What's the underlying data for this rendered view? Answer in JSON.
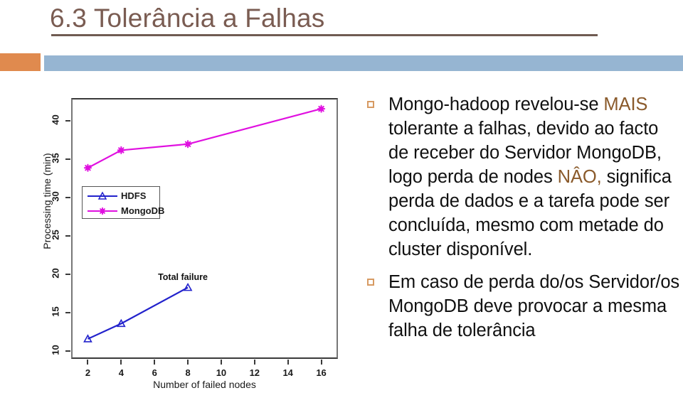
{
  "slide": {
    "title": "6.3 Tolerância a Falhas",
    "title_color": "#7A5C52",
    "accent_orange": "#E08A4E",
    "band_blue": "#96B5D2",
    "highlight_color": "#8A5A2B"
  },
  "chart_data": {
    "type": "line",
    "title": "",
    "xlabel": "Number of failed nodes",
    "ylabel": "Processing time (min)",
    "xlim": [
      1,
      17
    ],
    "ylim": [
      9,
      43
    ],
    "xticks": [
      2,
      4,
      6,
      8,
      10,
      12,
      14,
      16
    ],
    "yticks": [
      10,
      15,
      20,
      25,
      30,
      35,
      40
    ],
    "grid": false,
    "legend_position": "center-left",
    "annotations": [
      {
        "text": "Total failure",
        "x": 8,
        "y": 19.6
      }
    ],
    "series": [
      {
        "name": "HDFS",
        "color": "#2222CC",
        "marker": "triangle",
        "x": [
          2,
          4,
          8
        ],
        "values": [
          11.6,
          13.6,
          18.3
        ]
      },
      {
        "name": "MongoDB",
        "color": "#E010E0",
        "marker": "star",
        "x": [
          2,
          4,
          8,
          16
        ],
        "values": [
          33.9,
          36.2,
          37.0,
          41.6
        ]
      }
    ]
  },
  "content": {
    "bullets": [
      {
        "id": "bullet-tolerancia",
        "segments": [
          {
            "text": "Mongo-hadoop revelou-se ",
            "highlight": false
          },
          {
            "text": "MAIS",
            "highlight": true
          },
          {
            "text": " tolerante a falhas, devido ao facto de receber do Servidor MongoDB, logo perda de nodes ",
            "highlight": false
          },
          {
            "text": "NÂO,",
            "highlight": true
          },
          {
            "text": " significa perda de dados e a tarefa pode ser concluída, mesmo com metade do cluster disponível.",
            "highlight": false
          }
        ]
      },
      {
        "id": "bullet-perda-servidor",
        "segments": [
          {
            "text": "Em caso de perda do/os Servidor/os MongoDB deve provocar a mesma falha de tolerância",
            "highlight": false
          }
        ]
      }
    ]
  }
}
